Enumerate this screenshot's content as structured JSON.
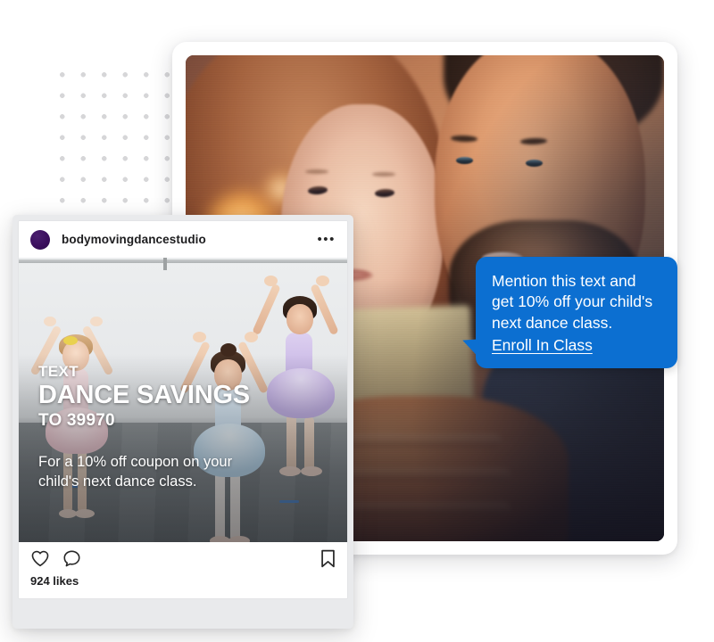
{
  "colors": {
    "bubble_blue": "#0c6fd1",
    "bubble_text": "#ffffff",
    "overlay_text": "#ffffff",
    "ig_text": "#1d1d1f",
    "dot_grid": "#d6d6d8",
    "avatar": "#3b0f5e"
  },
  "dot_grid": {
    "label": "decorative-dot-grid"
  },
  "photo_card": {
    "alt": "father and young daughter looking at a glowing phone screen"
  },
  "speech_bubble": {
    "lines": [
      "Mention this text and",
      "get 10% off your child's",
      "next dance class."
    ],
    "link_label": "Enroll In Class"
  },
  "instagram_post": {
    "username": "bodymovingdancestudio",
    "more_label": "•••",
    "photo_alt": "three young ballet dancers posing in a dance studio",
    "overlay": {
      "eyebrow": "TEXT",
      "headline": "DANCE SAVINGS",
      "keyword_line": "TO 39970",
      "subtext_lines": [
        "For a 10% off coupon on your",
        "child's next dance class."
      ]
    },
    "actions": {
      "like_icon": "heart-icon",
      "comment_icon": "comment-icon",
      "save_icon": "bookmark-icon"
    },
    "likes": "924 likes"
  }
}
